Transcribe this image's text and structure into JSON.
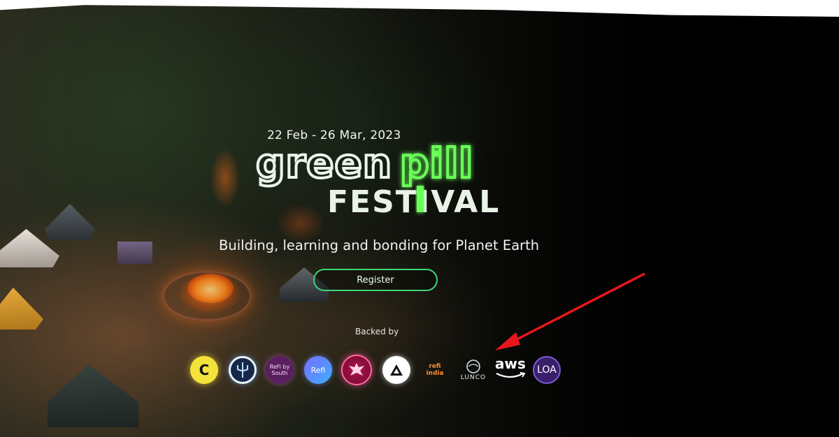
{
  "hero": {
    "date_range": "22 Feb - 26 Mar, 2023",
    "logo_word_1": "green",
    "logo_word_2": "pill",
    "logo_word_3": "FESTIVAL",
    "tagline": "Building, learning and bonding for Planet Earth",
    "register_label": "Register"
  },
  "backers": {
    "label": "Backed by",
    "logos": [
      {
        "name": "C",
        "icon": "c-logo"
      },
      {
        "name": "",
        "icon": "trident-logo"
      },
      {
        "name": "ReFi by South",
        "icon": "refi-south-logo"
      },
      {
        "name": "Refi",
        "icon": "refi-logo"
      },
      {
        "name": "",
        "icon": "phoenix-logo"
      },
      {
        "name": "",
        "icon": "triangle-logo"
      },
      {
        "name": "refi india",
        "icon": "refi-india-logo"
      },
      {
        "name": "LUNCO",
        "icon": "lunco-logo"
      },
      {
        "name": "aws",
        "icon": "aws-logo"
      },
      {
        "name": "LOA",
        "icon": "loa-logo"
      }
    ]
  },
  "annotation": {
    "icon": "red-arrow-icon",
    "color": "#e8161b"
  },
  "colors": {
    "accent_green": "#3ed67a",
    "logo_green": "#6bff5a",
    "background": "#000000"
  }
}
